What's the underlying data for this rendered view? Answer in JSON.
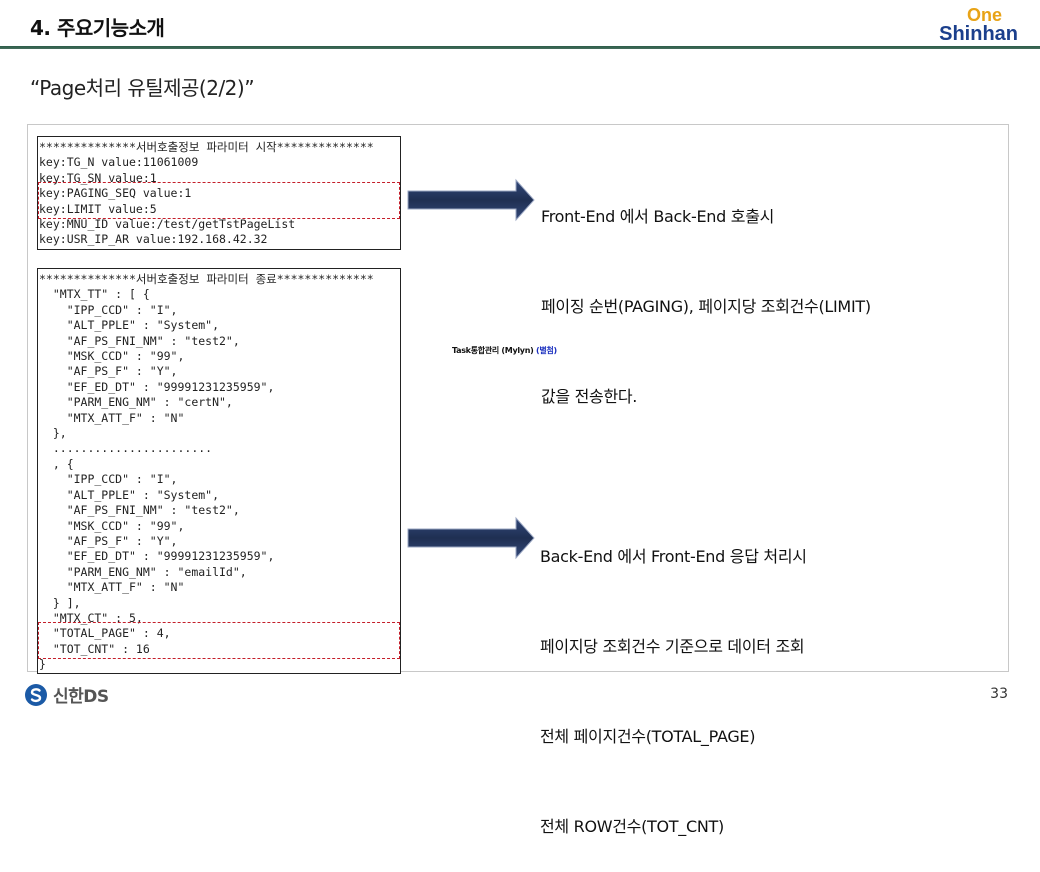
{
  "header": {
    "title": "4. 주요기능소개",
    "logo_top": "One",
    "logo_bottom": "Shinhan"
  },
  "subtitle": "“Page처리 유틸제공(2/2)”",
  "request_log": {
    "lines": [
      "**************서버호출정보 파라미터 시작**************",
      "key:TG_N value:11061009",
      "key:TG_SN value:1",
      "key:PAGING_SEQ value:1",
      "key:LIMIT value:5",
      "key:MNU_ID value:/test/getTstPageList",
      "key:USR_IP_AR value:192.168.42.32"
    ]
  },
  "response_log": {
    "lines": [
      "**************서버호출정보 파라미터 종료**************",
      "  \"MTX_TT\" : [ {",
      "    \"IPP_CCD\" : \"I\",",
      "    \"ALT_PPLE\" : \"System\",",
      "    \"AF_PS_FNI_NM\" : \"test2\",",
      "    \"MSK_CCD\" : \"99\",",
      "    \"AF_PS_F\" : \"Y\",",
      "    \"EF_ED_DT\" : \"99991231235959\",",
      "    \"PARM_ENG_NM\" : \"certN\",",
      "    \"MTX_ATT_F\" : \"N\"",
      "  },",
      "  .......................",
      "  , {",
      "    \"IPP_CCD\" : \"I\",",
      "    \"ALT_PPLE\" : \"System\",",
      "    \"AF_PS_FNI_NM\" : \"test2\",",
      "    \"MSK_CCD\" : \"99\",",
      "    \"AF_PS_F\" : \"Y\",",
      "    \"EF_ED_DT\" : \"99991231235959\",",
      "    \"PARM_ENG_NM\" : \"emailId\",",
      "    \"MTX_ATT_F\" : \"N\"",
      "  } ],",
      "  \"MTX_CT\" : 5,",
      "  \"TOTAL_PAGE\" : 4,",
      "  \"TOT_CNT\" : 16",
      "}"
    ]
  },
  "request_desc": {
    "lines": [
      "Front-End 에서 Back-End 호출시",
      "페이징 순번(PAGING), 페이지당 조회건수(LIMIT)",
      "값을 전송한다."
    ]
  },
  "response_desc": {
    "lines": [
      "Back-End 에서 Front-End 응답 처리시",
      "페이지당 조회건수 기준으로 데이터 조회",
      "전체 페이지건수(TOTAL_PAGE)",
      "전체 ROW건수(TOT_CNT)"
    ]
  },
  "mylyn_note": {
    "text": "Task통합관리 (Mylyn)",
    "link": "(별첨)"
  },
  "footer": {
    "logo_text": "신한DS",
    "page_number": "33"
  },
  "colors": {
    "header_rule": "#2c5c49",
    "arrow": "#1f2f52",
    "highlight": "#c41e2a",
    "logo_one": "#e8a317",
    "logo_shinhan": "#1b3f8c"
  },
  "icons": {
    "arrow": "right-arrow-icon",
    "footer": "shinhan-logo-icon"
  }
}
